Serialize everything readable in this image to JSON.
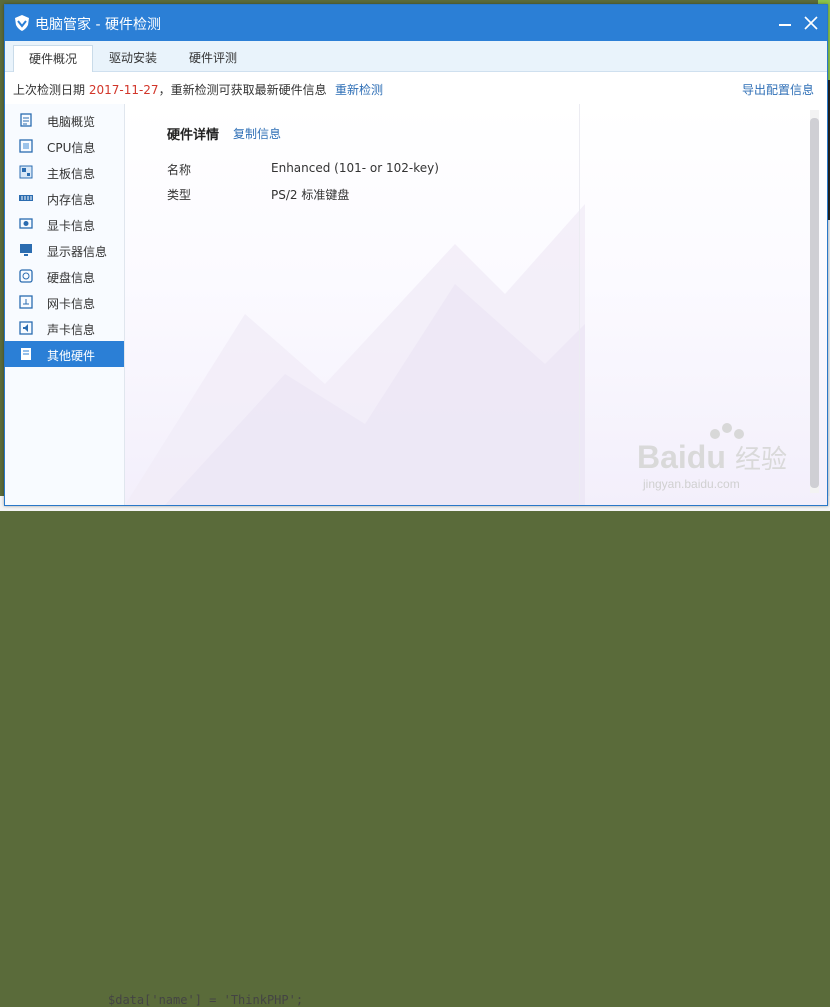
{
  "window": {
    "title": "电脑管家 - 硬件检测"
  },
  "tabs": [
    {
      "label": "硬件概况",
      "active": true
    },
    {
      "label": "驱动安装",
      "active": false
    },
    {
      "label": "硬件评测",
      "active": false
    }
  ],
  "infobar": {
    "prefix": "上次检测日期 ",
    "date": "2017-11-27",
    "suffix": "，重新检测可获取最新硬件信息",
    "recheck_label": "重新检测",
    "export_label": "导出配置信息"
  },
  "sidebar": {
    "items": [
      {
        "label": "电脑概览",
        "icon": "clipboard-icon"
      },
      {
        "label": "CPU信息",
        "icon": "cpu-icon"
      },
      {
        "label": "主板信息",
        "icon": "motherboard-icon"
      },
      {
        "label": "内存信息",
        "icon": "memory-icon"
      },
      {
        "label": "显卡信息",
        "icon": "graphics-card-icon"
      },
      {
        "label": "显示器信息",
        "icon": "monitor-icon"
      },
      {
        "label": "硬盘信息",
        "icon": "harddisk-icon"
      },
      {
        "label": "网卡信息",
        "icon": "network-card-icon"
      },
      {
        "label": "声卡信息",
        "icon": "sound-card-icon"
      },
      {
        "label": "其他硬件",
        "icon": "other-hardware-icon",
        "active": true
      }
    ]
  },
  "detail": {
    "title": "硬件详情",
    "copy_label": "复制信息",
    "rows": [
      {
        "label": "名称",
        "value": "Enhanced (101- or 102-key)"
      },
      {
        "label": "类型",
        "value": "PS/2 标准键盘"
      }
    ]
  },
  "watermark": {
    "brand": "Baidu",
    "brand_cn": "经验",
    "url": "jingyan.baidu.com"
  },
  "background": {
    "code_snippet": "$data['name'] = 'ThinkPHP';"
  },
  "colors": {
    "accent": "#2b7fd6",
    "link": "#2f6fb6",
    "date_red": "#d2362a"
  }
}
